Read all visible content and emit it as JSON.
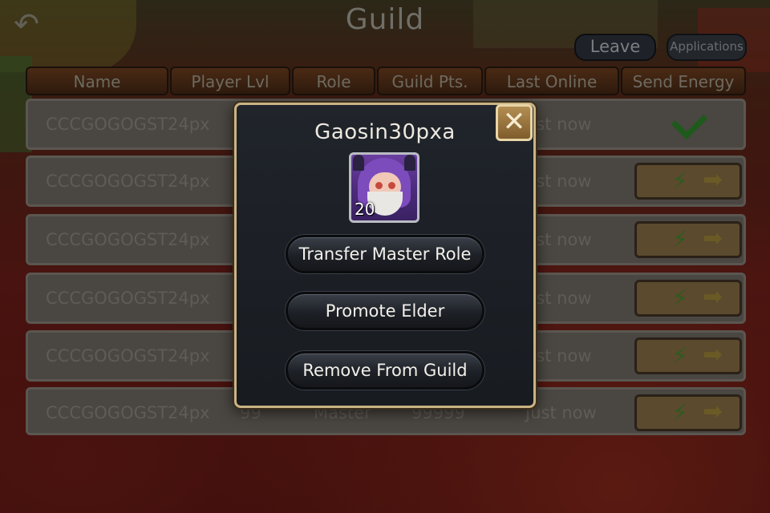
{
  "header": {
    "title": "Guild",
    "back_icon": "back-arrow-icon",
    "leave_label": "Leave",
    "applications_label": "Applications"
  },
  "table": {
    "columns": [
      "Name",
      "Player Lvl",
      "Role",
      "Guild Pts.",
      "Last Online",
      "Send Energy"
    ],
    "rows": [
      {
        "name": "CCCGOGOGST24px",
        "lvl": "",
        "role": "",
        "pts": "",
        "online": "ust now",
        "energy": "check"
      },
      {
        "name": "CCCGOGOGST24px",
        "lvl": "",
        "role": "",
        "pts": "",
        "online": "ust now",
        "energy": "send"
      },
      {
        "name": "CCCGOGOGST24px",
        "lvl": "",
        "role": "",
        "pts": "",
        "online": "ust now",
        "energy": "send"
      },
      {
        "name": "CCCGOGOGST24px",
        "lvl": "",
        "role": "",
        "pts": "",
        "online": "ust now",
        "energy": "send"
      },
      {
        "name": "CCCGOGOGST24px",
        "lvl": "",
        "role": "",
        "pts": "",
        "online": "ust now",
        "energy": "send"
      },
      {
        "name": "CCCGOGOGST24px",
        "lvl": "99",
        "role": "Master",
        "pts": "99999",
        "online": "Just now",
        "energy": "send"
      }
    ]
  },
  "modal": {
    "player_name": "Gaosin30pxa",
    "avatar_level": "20",
    "close_icon": "close-x-icon",
    "buttons": {
      "transfer": "Transfer Master Role",
      "promote": "Promote Elder",
      "remove": "Remove From Guild"
    }
  },
  "colors": {
    "modal_border": "#cbb384",
    "modal_bg": "#1c1f25",
    "energy_bolt": "#2d5b1f",
    "check": "#1d5a1b"
  }
}
